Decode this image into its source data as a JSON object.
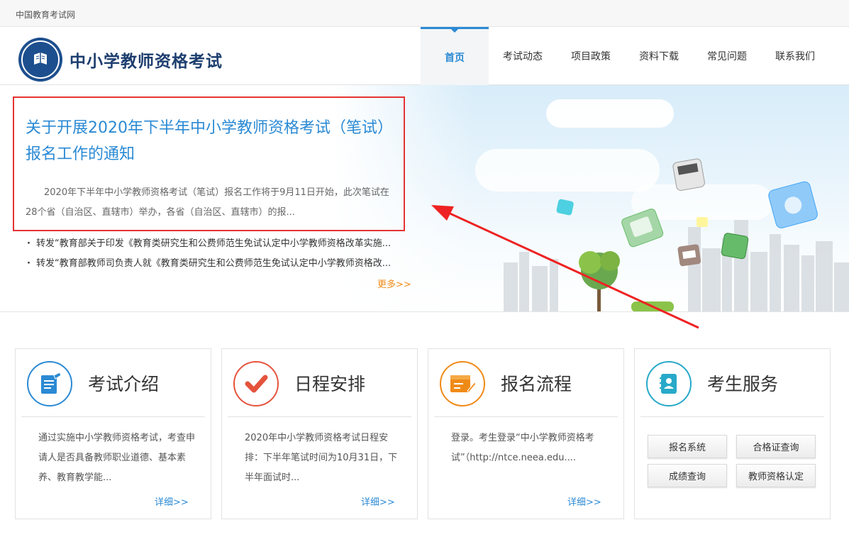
{
  "topbar": {
    "site_name": "中国教育考试网"
  },
  "header": {
    "brand": "中小学教师资格考试",
    "nav": [
      "首页",
      "考试动态",
      "项目政策",
      "资料下载",
      "常见问题",
      "联系我们"
    ]
  },
  "banner": {
    "headline": "关于开展2020年下半年中小学教师资格考试（笔试）报名工作的通知",
    "summary": "2020年下半年中小学教师资格考试（笔试）报名工作将于9月11日开始，此次笔试在28个省（自治区、直辖市）举办，各省（自治区、直辖市）的报...",
    "news": [
      "转发“教育部关于印发《教育类研究生和公费师范生免试认定中小学教师资格改革实施...",
      "转发“教育部教师司负责人就《教育类研究生和公费师范生免试认定中小学教师资格改..."
    ],
    "more": "更多>>"
  },
  "cards": [
    {
      "title": "考试介绍",
      "icon": "document-pen-icon",
      "text": "通过实施中小学教师资格考试，考查申请人是否具备教师职业道德、基本素养、教育教学能...",
      "more": "详细>>"
    },
    {
      "title": "日程安排",
      "icon": "checkmark-icon",
      "text": "2020年中小学教师资格考试日程安排：下半年笔试时间为10月31日，下半年面试时...",
      "more": "详细>>"
    },
    {
      "title": "报名流程",
      "icon": "form-edit-icon",
      "text": "登录。考生登录“中小学教师资格考试”（http://ntce.neea.edu....",
      "more": "详细>>"
    },
    {
      "title": "考生服务",
      "icon": "contact-book-icon"
    }
  ],
  "services": [
    "报名系统",
    "合格证查询",
    "成绩查询",
    "教师资格认定"
  ],
  "colors": {
    "accent": "#2b8ad4",
    "highlight_border": "#e53333",
    "more_orange": "#f08a16",
    "check_red": "#e5533d",
    "form_orange": "#f08a16",
    "service_teal": "#27a9c9"
  }
}
